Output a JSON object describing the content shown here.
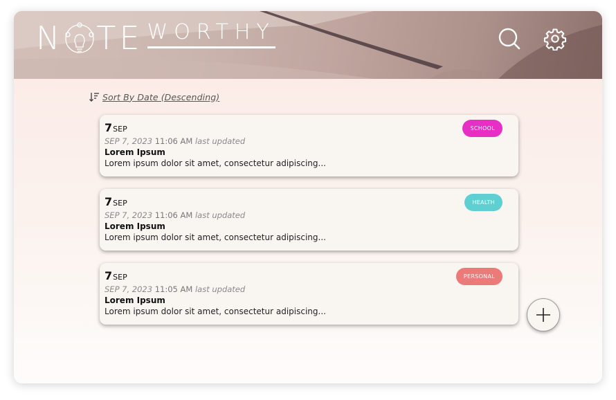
{
  "app": {
    "logo_note": "N TE",
    "logo_worthy": "WORTHY"
  },
  "header": {
    "icons": [
      "search-icon",
      "gear-icon"
    ]
  },
  "sort": {
    "label": "Sort By Date (Descending)",
    "icon": "sort-descending-icon"
  },
  "notes": [
    {
      "day": "7",
      "month": "SEP",
      "updated_date": "SEP 7, 2023",
      "updated_time": "11:06 AM",
      "updated_suffix": "last updated",
      "title": "Lorem Ipsum",
      "preview": "Lorem ipsum dolor sit amet, consectetur adipiscing...",
      "tag": "SCHOOL",
      "tag_color": "#e52fc5"
    },
    {
      "day": "7",
      "month": "SEP",
      "updated_date": "SEP 7, 2023",
      "updated_time": "11:06 AM",
      "updated_suffix": "last updated",
      "title": "Lorem Ipsum",
      "preview": "Lorem ipsum dolor sit amet, consectetur adipiscing...",
      "tag": "HEALTH",
      "tag_color": "#5fcfd2"
    },
    {
      "day": "7",
      "month": "SEP",
      "updated_date": "SEP 7, 2023",
      "updated_time": "11:05 AM",
      "updated_suffix": "last updated",
      "title": "Lorem Ipsum",
      "preview": "Lorem ipsum dolor sit amet, consectetur adipiscing...",
      "tag": "PERSONAL",
      "tag_color": "#ec7a78"
    }
  ],
  "add_button": {
    "icon": "plus-icon"
  }
}
